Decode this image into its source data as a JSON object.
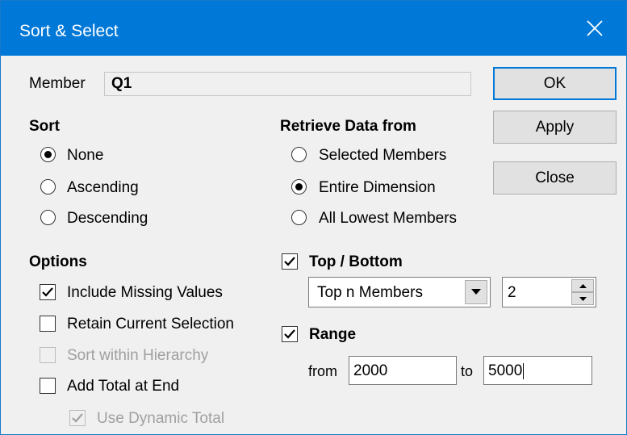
{
  "window": {
    "title": "Sort & Select"
  },
  "member": {
    "label": "Member",
    "value": "Q1"
  },
  "buttons": {
    "ok": "OK",
    "apply": "Apply",
    "close": "Close"
  },
  "sort": {
    "heading": "Sort",
    "options": [
      {
        "label": "None",
        "selected": true
      },
      {
        "label": "Ascending",
        "selected": false
      },
      {
        "label": "Descending",
        "selected": false
      }
    ]
  },
  "retrieve": {
    "heading": "Retrieve Data from",
    "options": [
      {
        "label": "Selected Members",
        "selected": false
      },
      {
        "label": "Entire Dimension",
        "selected": true
      },
      {
        "label": "All Lowest Members",
        "selected": false
      }
    ]
  },
  "options": {
    "heading": "Options",
    "items": [
      {
        "label": "Include Missing Values",
        "checked": true,
        "enabled": true
      },
      {
        "label": "Retain Current Selection",
        "checked": false,
        "enabled": true
      },
      {
        "label": "Sort within Hierarchy",
        "checked": false,
        "enabled": false
      },
      {
        "label": "Add Total at End",
        "checked": false,
        "enabled": true
      },
      {
        "label": "Use Dynamic Total",
        "checked": true,
        "enabled": false
      }
    ]
  },
  "top_bottom": {
    "label": "Top / Bottom",
    "checked": true,
    "mode_value": "Top n Members",
    "count_value": "2"
  },
  "range": {
    "label": "Range",
    "checked": true,
    "from_label": "from",
    "from_value": "2000",
    "to_label": "to",
    "to_value": "5000"
  },
  "colors": {
    "titlebar": "#0078d7",
    "dialog_bg": "#f0f0f0",
    "disabled_text": "#a0a0a0"
  },
  "icons": {
    "close": "close-icon",
    "dropdown": "chevron-down-icon",
    "spin_up": "spin-up-icon",
    "spin_down": "spin-down-icon",
    "check": "checkmark-icon"
  }
}
